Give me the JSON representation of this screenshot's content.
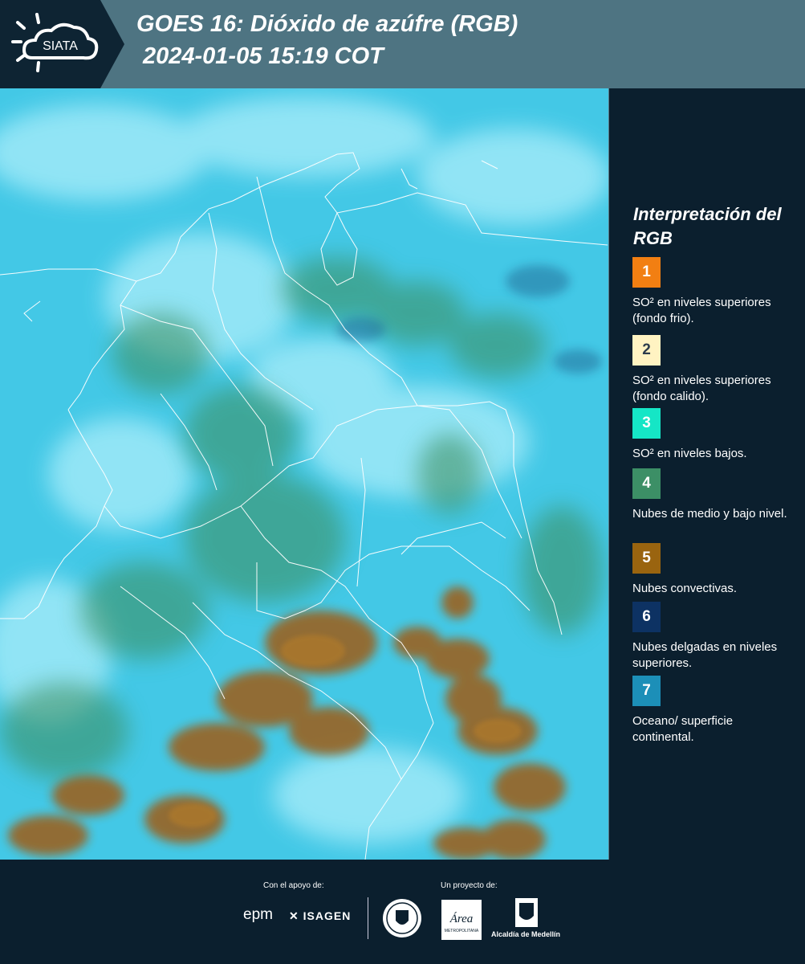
{
  "header": {
    "logo_text": "SIATA",
    "title_line1": "GOES 16: Dióxido de azúfre (RGB)",
    "title_line2": "2024-01-05 15:19 COT"
  },
  "legend": {
    "title": "Interpretación del RGB",
    "items": [
      {
        "number": "1",
        "color": "#f27f12",
        "text": "SO² en niveles superiores (fondo frio)."
      },
      {
        "number": "2",
        "color": "#fff3c2",
        "text": "SO² en niveles superiores (fondo calido)."
      },
      {
        "number": "3",
        "color": "#15e6c6",
        "text": "SO² en niveles bajos."
      },
      {
        "number": "4",
        "color": "#3c8f66",
        "text": "Nubes de medio y bajo nivel."
      },
      {
        "number": "5",
        "color": "#9a640f",
        "text": "Nubes convectivas."
      },
      {
        "number": "6",
        "color": "#0d3263",
        "text": "Nubes delgadas en niveles superiores."
      },
      {
        "number": "7",
        "color": "#1c8fb8",
        "text": "Oceano/ superficie continental."
      }
    ]
  },
  "footer": {
    "support_label": "Con el apoyo de:",
    "project_label": "Un proyecto de:",
    "sponsors": [
      "epm",
      "ISAGEN"
    ],
    "partners": [
      "Área Metropolitana Valle de Aburrá",
      "Alcaldía de Medellín"
    ],
    "epm_text": "epm",
    "isagen_text": "ISAGEN",
    "area_text": "Área",
    "area_subtext": "METROPOLITANA",
    "alcaldia_text": "Alcaldía de Medellín"
  },
  "colors": {
    "header_bg": "#4e7482",
    "logo_bg": "#0e2433",
    "panel_bg": "#0b1f2e",
    "map_sky": "#43c8e6",
    "map_cloud": "#a4f0fa",
    "map_green": "#3c8c5e",
    "map_convective": "#9a6420",
    "border_lines": "#ffffff"
  }
}
